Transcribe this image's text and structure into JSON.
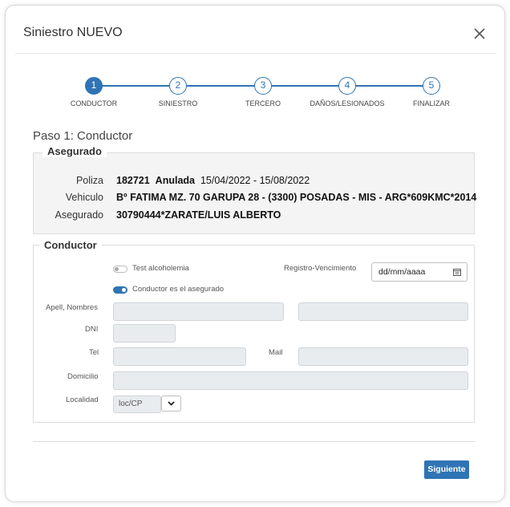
{
  "modal": {
    "title": "Siniestro NUEVO"
  },
  "stepper": {
    "steps": [
      {
        "number": "1",
        "label": "CONDUCTOR",
        "active": true
      },
      {
        "number": "2",
        "label": "SINIESTRO",
        "active": false
      },
      {
        "number": "3",
        "label": "TERCERO",
        "active": false
      },
      {
        "number": "4",
        "label": "DAÑOS/LESIONADOS",
        "active": false
      },
      {
        "number": "5",
        "label": "FINALIZAR",
        "active": false
      }
    ]
  },
  "paso_title": "Paso 1: Conductor",
  "asegurado": {
    "legend": "Asegurado",
    "poliza_label": "Poliza",
    "poliza_number": "182721",
    "poliza_status": "Anulada",
    "poliza_dates": "15/04/2022 -  15/08/2022",
    "vehiculo_label": "Vehiculo",
    "vehiculo_value": "Bº FATIMA MZ. 70 GARUPA 28 - (3300) POSADAS - MIS - ARG*609KMC*2014",
    "asegurado_label": "Asegurado",
    "asegurado_value": "30790444*ZARATE/LUIS ALBERTO"
  },
  "conductor": {
    "legend": "Conductor",
    "test_alcoholemia_label": "Test alcoholemia",
    "test_alcoholemia_on": false,
    "registro_label": "Registro-Vencimiento",
    "registro_placeholder": "dd/mm/aaaa",
    "conductor_asegurado_label": "Conductor es el asegurado",
    "conductor_asegurado_on": true,
    "apell_label": "Apell, Nombres",
    "dni_label": "DNI",
    "tel_label": "Tel",
    "mail_label": "Mail",
    "domicilio_label": "Domicilio",
    "localidad_label": "Localidad",
    "localidad_value": "loc/CP"
  },
  "footer": {
    "next_label": "Siguiente"
  },
  "colors": {
    "accent": "#2f74b5",
    "disabled_field": "#e9ecef",
    "panel_bg": "#f4f4f4"
  },
  "icons": {
    "close": "close-icon",
    "calendar": "calendar-icon",
    "dropdown": "chevron-down-icon"
  }
}
